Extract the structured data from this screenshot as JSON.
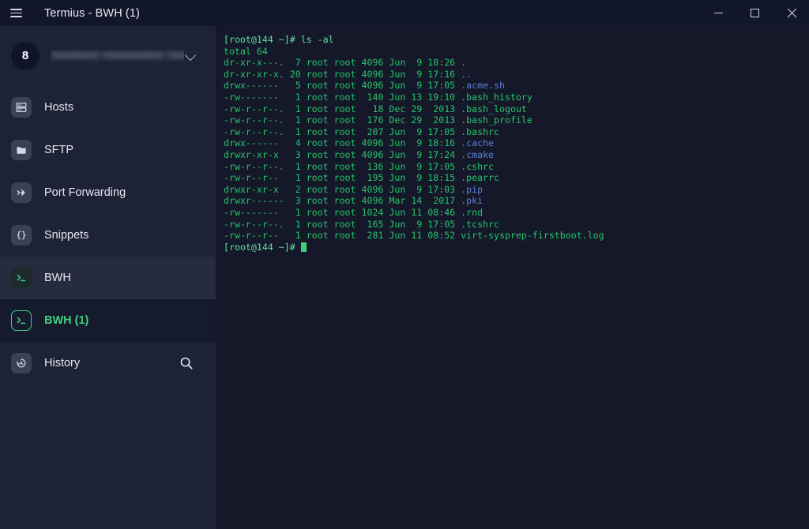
{
  "window": {
    "title": "Termius - BWH (1)",
    "menu_icon": "hamburger-icon",
    "controls": {
      "minimize": "minimize-icon",
      "maximize": "maximize-icon",
      "close": "close-icon"
    }
  },
  "colors": {
    "titlebar_bg": "#12162a",
    "sidebar_bg": "#1d2235",
    "terminal_bg": "#141829",
    "accent_green": "#3fd07f",
    "terminal_green": "#27c46b",
    "terminal_blue": "#5a7fd6",
    "row_hover_bg": "#262b3d",
    "row_active_bg": "#151a2c"
  },
  "account": {
    "avatar_initial": "8",
    "name_redacted": "aaaaaaaa aaaaaaaaaa aaaaaa",
    "chevron": "chevron-down-icon"
  },
  "sidebar": {
    "items": [
      {
        "label": "Hosts",
        "icon": "server-rack-icon",
        "state": "normal"
      },
      {
        "label": "SFTP",
        "icon": "folder-icon",
        "state": "normal"
      },
      {
        "label": "Port Forwarding",
        "icon": "forward-arrow-icon",
        "state": "normal"
      },
      {
        "label": "Snippets",
        "icon": "braces-icon",
        "state": "normal"
      },
      {
        "label": "BWH",
        "icon": "terminal-icon",
        "state": "session"
      },
      {
        "label": "BWH (1)",
        "icon": "terminal-icon",
        "state": "session-active"
      },
      {
        "label": "History",
        "icon": "history-clock-icon",
        "state": "normal",
        "trailing_icon": "search-icon"
      }
    ]
  },
  "terminal": {
    "lines": [
      [
        {
          "t": "[root@144 ~]# ls -al",
          "c": "prompt"
        }
      ],
      [
        {
          "t": "total 64",
          "c": "green"
        }
      ],
      [
        {
          "t": "dr-xr-x---.  7 root root 4096 Jun  9 18:26 ",
          "c": "green"
        },
        {
          "t": ".",
          "c": "blue"
        }
      ],
      [
        {
          "t": "dr-xr-xr-x. 20 root root 4096 Jun  9 17:16 ",
          "c": "green"
        },
        {
          "t": "..",
          "c": "blue"
        }
      ],
      [
        {
          "t": "drwx------   5 root root 4096 Jun  9 17:05 ",
          "c": "green"
        },
        {
          "t": ".acme.sh",
          "c": "blue"
        }
      ],
      [
        {
          "t": "-rw-------   1 root root  140 Jun 13 19:10 .bash_history",
          "c": "green"
        }
      ],
      [
        {
          "t": "-rw-r--r--.  1 root root   18 Dec 29  2013 .bash_logout",
          "c": "green"
        }
      ],
      [
        {
          "t": "-rw-r--r--.  1 root root  176 Dec 29  2013 .bash_profile",
          "c": "green"
        }
      ],
      [
        {
          "t": "-rw-r--r--.  1 root root  207 Jun  9 17:05 .bashrc",
          "c": "green"
        }
      ],
      [
        {
          "t": "drwx------   4 root root 4096 Jun  9 18:16 ",
          "c": "green"
        },
        {
          "t": ".cache",
          "c": "blue"
        }
      ],
      [
        {
          "t": "drwxr-xr-x   3 root root 4096 Jun  9 17:24 ",
          "c": "green"
        },
        {
          "t": ".cmake",
          "c": "blue"
        }
      ],
      [
        {
          "t": "-rw-r--r--.  1 root root  136 Jun  9 17:05 .cshrc",
          "c": "green"
        }
      ],
      [
        {
          "t": "-rw-r--r--   1 root root  195 Jun  9 18:15 .pearrc",
          "c": "green"
        }
      ],
      [
        {
          "t": "drwxr-xr-x   2 root root 4096 Jun  9 17:03 ",
          "c": "green"
        },
        {
          "t": ".pip",
          "c": "blue"
        }
      ],
      [
        {
          "t": "drwxr------  3 root root 4096 Mar 14  2017 ",
          "c": "green"
        },
        {
          "t": ".pki",
          "c": "blue"
        }
      ],
      [
        {
          "t": "-rw-------   1 root root 1024 Jun 11 08:46 .rnd",
          "c": "green"
        }
      ],
      [
        {
          "t": "-rw-r--r--.  1 root root  165 Jun  9 17:05 .tcshrc",
          "c": "green"
        }
      ],
      [
        {
          "t": "-rw-r--r--   1 root root  281 Jun 11 08:52 virt-sysprep-firstboot.log",
          "c": "green"
        }
      ]
    ],
    "prompt": "[root@144 ~]# ",
    "cursor": "block-cursor"
  }
}
